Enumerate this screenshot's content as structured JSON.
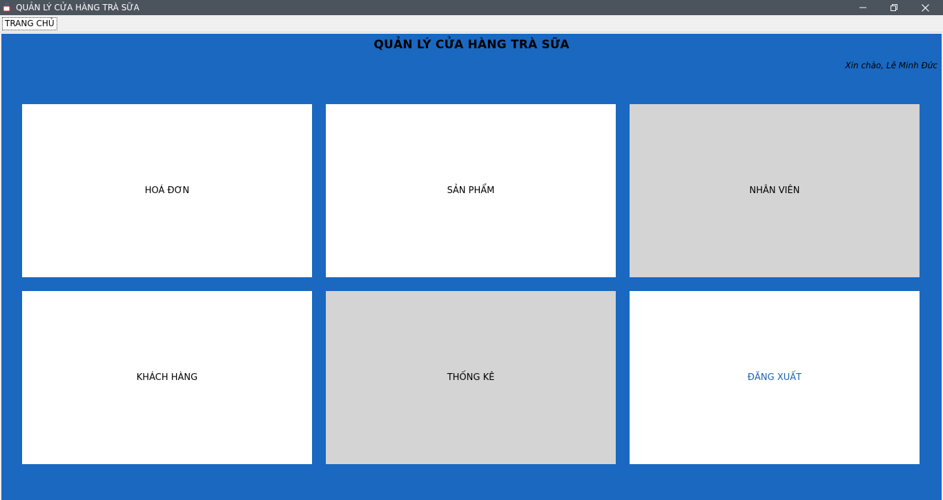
{
  "window": {
    "title": "QUẢN LÝ CỬA HÀNG TRÀ SỮA",
    "icon": "java-cup-icon"
  },
  "menu": {
    "items": [
      {
        "label": "TRANG CHỦ"
      }
    ]
  },
  "main": {
    "title": "QUẢN LÝ CỬA HÀNG TRÀ SỮA",
    "greeting": "Xin chào, Lê Minh Đức",
    "background_color": "#1a68c0",
    "tiles": [
      {
        "label": "HOÁ ĐƠN",
        "enabled": true
      },
      {
        "label": "SẢN PHẨM",
        "enabled": true
      },
      {
        "label": "NHÂN VIÊN",
        "enabled": false
      },
      {
        "label": "KHÁCH HÀNG",
        "enabled": true
      },
      {
        "label": "THỐNG KÊ",
        "enabled": false
      },
      {
        "label": "ĐĂNG XUẤT",
        "enabled": true,
        "text_color": "#1a62b0"
      }
    ]
  }
}
